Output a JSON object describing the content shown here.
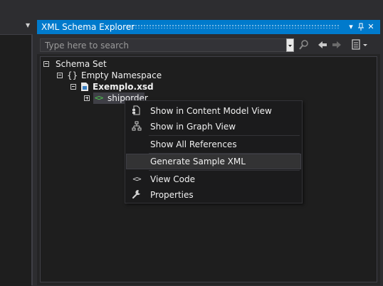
{
  "window": {
    "title": "XML Schema Explorer",
    "buttons": {
      "dropdown": "▾",
      "pin": "🖈",
      "close": "✕"
    }
  },
  "search": {
    "placeholder": "Type here to search",
    "value": ""
  },
  "tree": {
    "schema_set": "Schema Set",
    "namespace": "Empty Namespace",
    "file": "Exemplo.xsd",
    "element": "shiporder"
  },
  "context_menu": {
    "items": [
      {
        "label": "Show in Content Model View",
        "icon": "content-model-icon"
      },
      {
        "label": "Show in Graph View",
        "icon": "graph-view-icon"
      },
      {
        "label": "Show All References",
        "icon": ""
      },
      {
        "label": "Generate Sample XML",
        "icon": "",
        "highlighted": true
      },
      {
        "label": "View Code",
        "icon": "code-icon"
      },
      {
        "label": "Properties",
        "icon": "wrench-icon"
      }
    ]
  },
  "colors": {
    "accent": "#007acc",
    "background": "#2d2d30",
    "tree_bg": "#1e1e1e",
    "menu_bg": "#1b1b1c"
  }
}
